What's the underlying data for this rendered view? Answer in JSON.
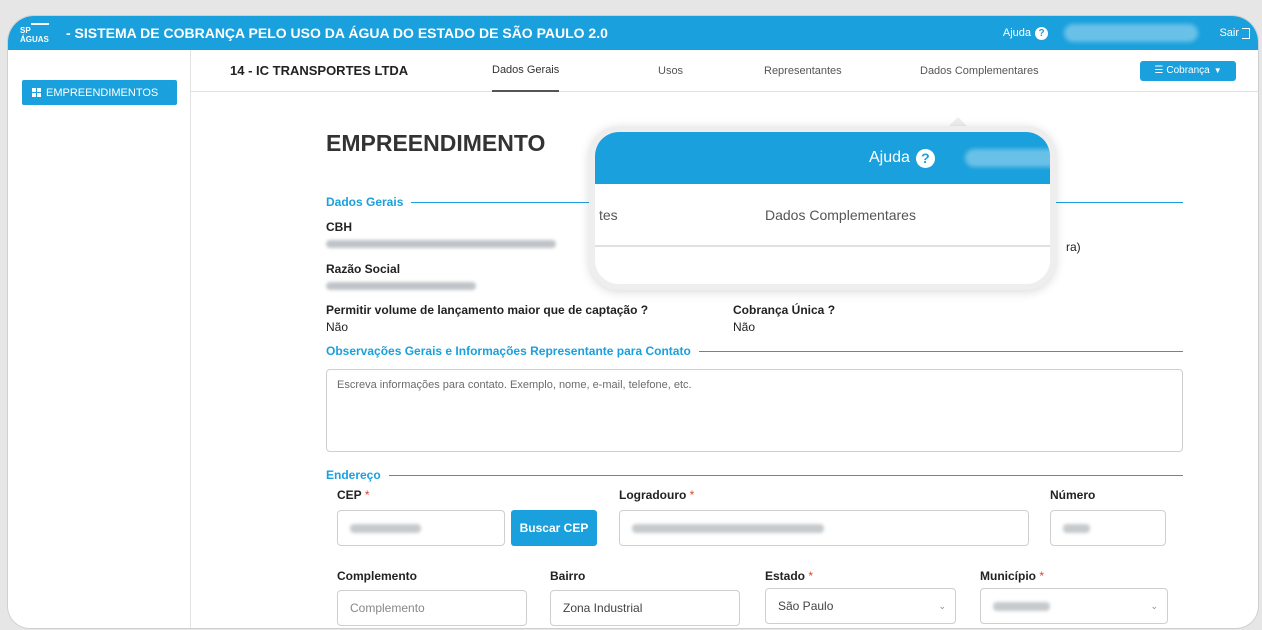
{
  "topbar": {
    "logo_text": "SP ÁGUAS",
    "title": "- SISTEMA DE COBRANÇA PELO USO DA ÁGUA DO ESTADO DE SÃO PAULO 2.0",
    "help_label": "Ajuda",
    "logout_label": "Sair"
  },
  "sidebar": {
    "items": [
      {
        "label": "EMPREENDIMENTOS"
      }
    ]
  },
  "subnav": {
    "company": "14 - IC TRANSPORTES LTDA",
    "tabs": [
      "Dados Gerais",
      "Usos",
      "Representantes",
      "Dados Complementares"
    ],
    "active_tab": "Dados Gerais",
    "cobranca_label": "Cobrança"
  },
  "main": {
    "title": "EMPREENDIMENTO",
    "dados_gerais": {
      "legend": "Dados Gerais",
      "cbh_label": "CBH",
      "razao_label": "Razão Social",
      "partial_right": "ra)",
      "permitir_label": "Permitir volume de lançamento maior que de captação ?",
      "permitir_value": "Não",
      "cobranca_unica_label": "Cobrança Única ?",
      "cobranca_unica_value": "Não"
    },
    "observacoes": {
      "legend": "Observações Gerais e Informações Representante para Contato",
      "placeholder": "Escreva informações para contato. Exemplo, nome, e-mail, telefone, etc."
    },
    "endereco": {
      "legend": "Endereço",
      "cep_label": "CEP",
      "buscar_cep": "Buscar CEP",
      "logradouro_label": "Logradouro",
      "numero_label": "Número",
      "complemento_label": "Complemento",
      "complemento_placeholder": "Complemento",
      "bairro_label": "Bairro",
      "bairro_value": "Zona Industrial",
      "estado_label": "Estado",
      "estado_value": "São Paulo",
      "municipio_label": "Município",
      "required_mark": "*"
    }
  },
  "zoom": {
    "help_label": "Ajuda",
    "tab_partial": "tes",
    "tab_full": "Dados Complementares"
  },
  "colors": {
    "accent": "#1aa0dc",
    "required": "#e0422f"
  }
}
